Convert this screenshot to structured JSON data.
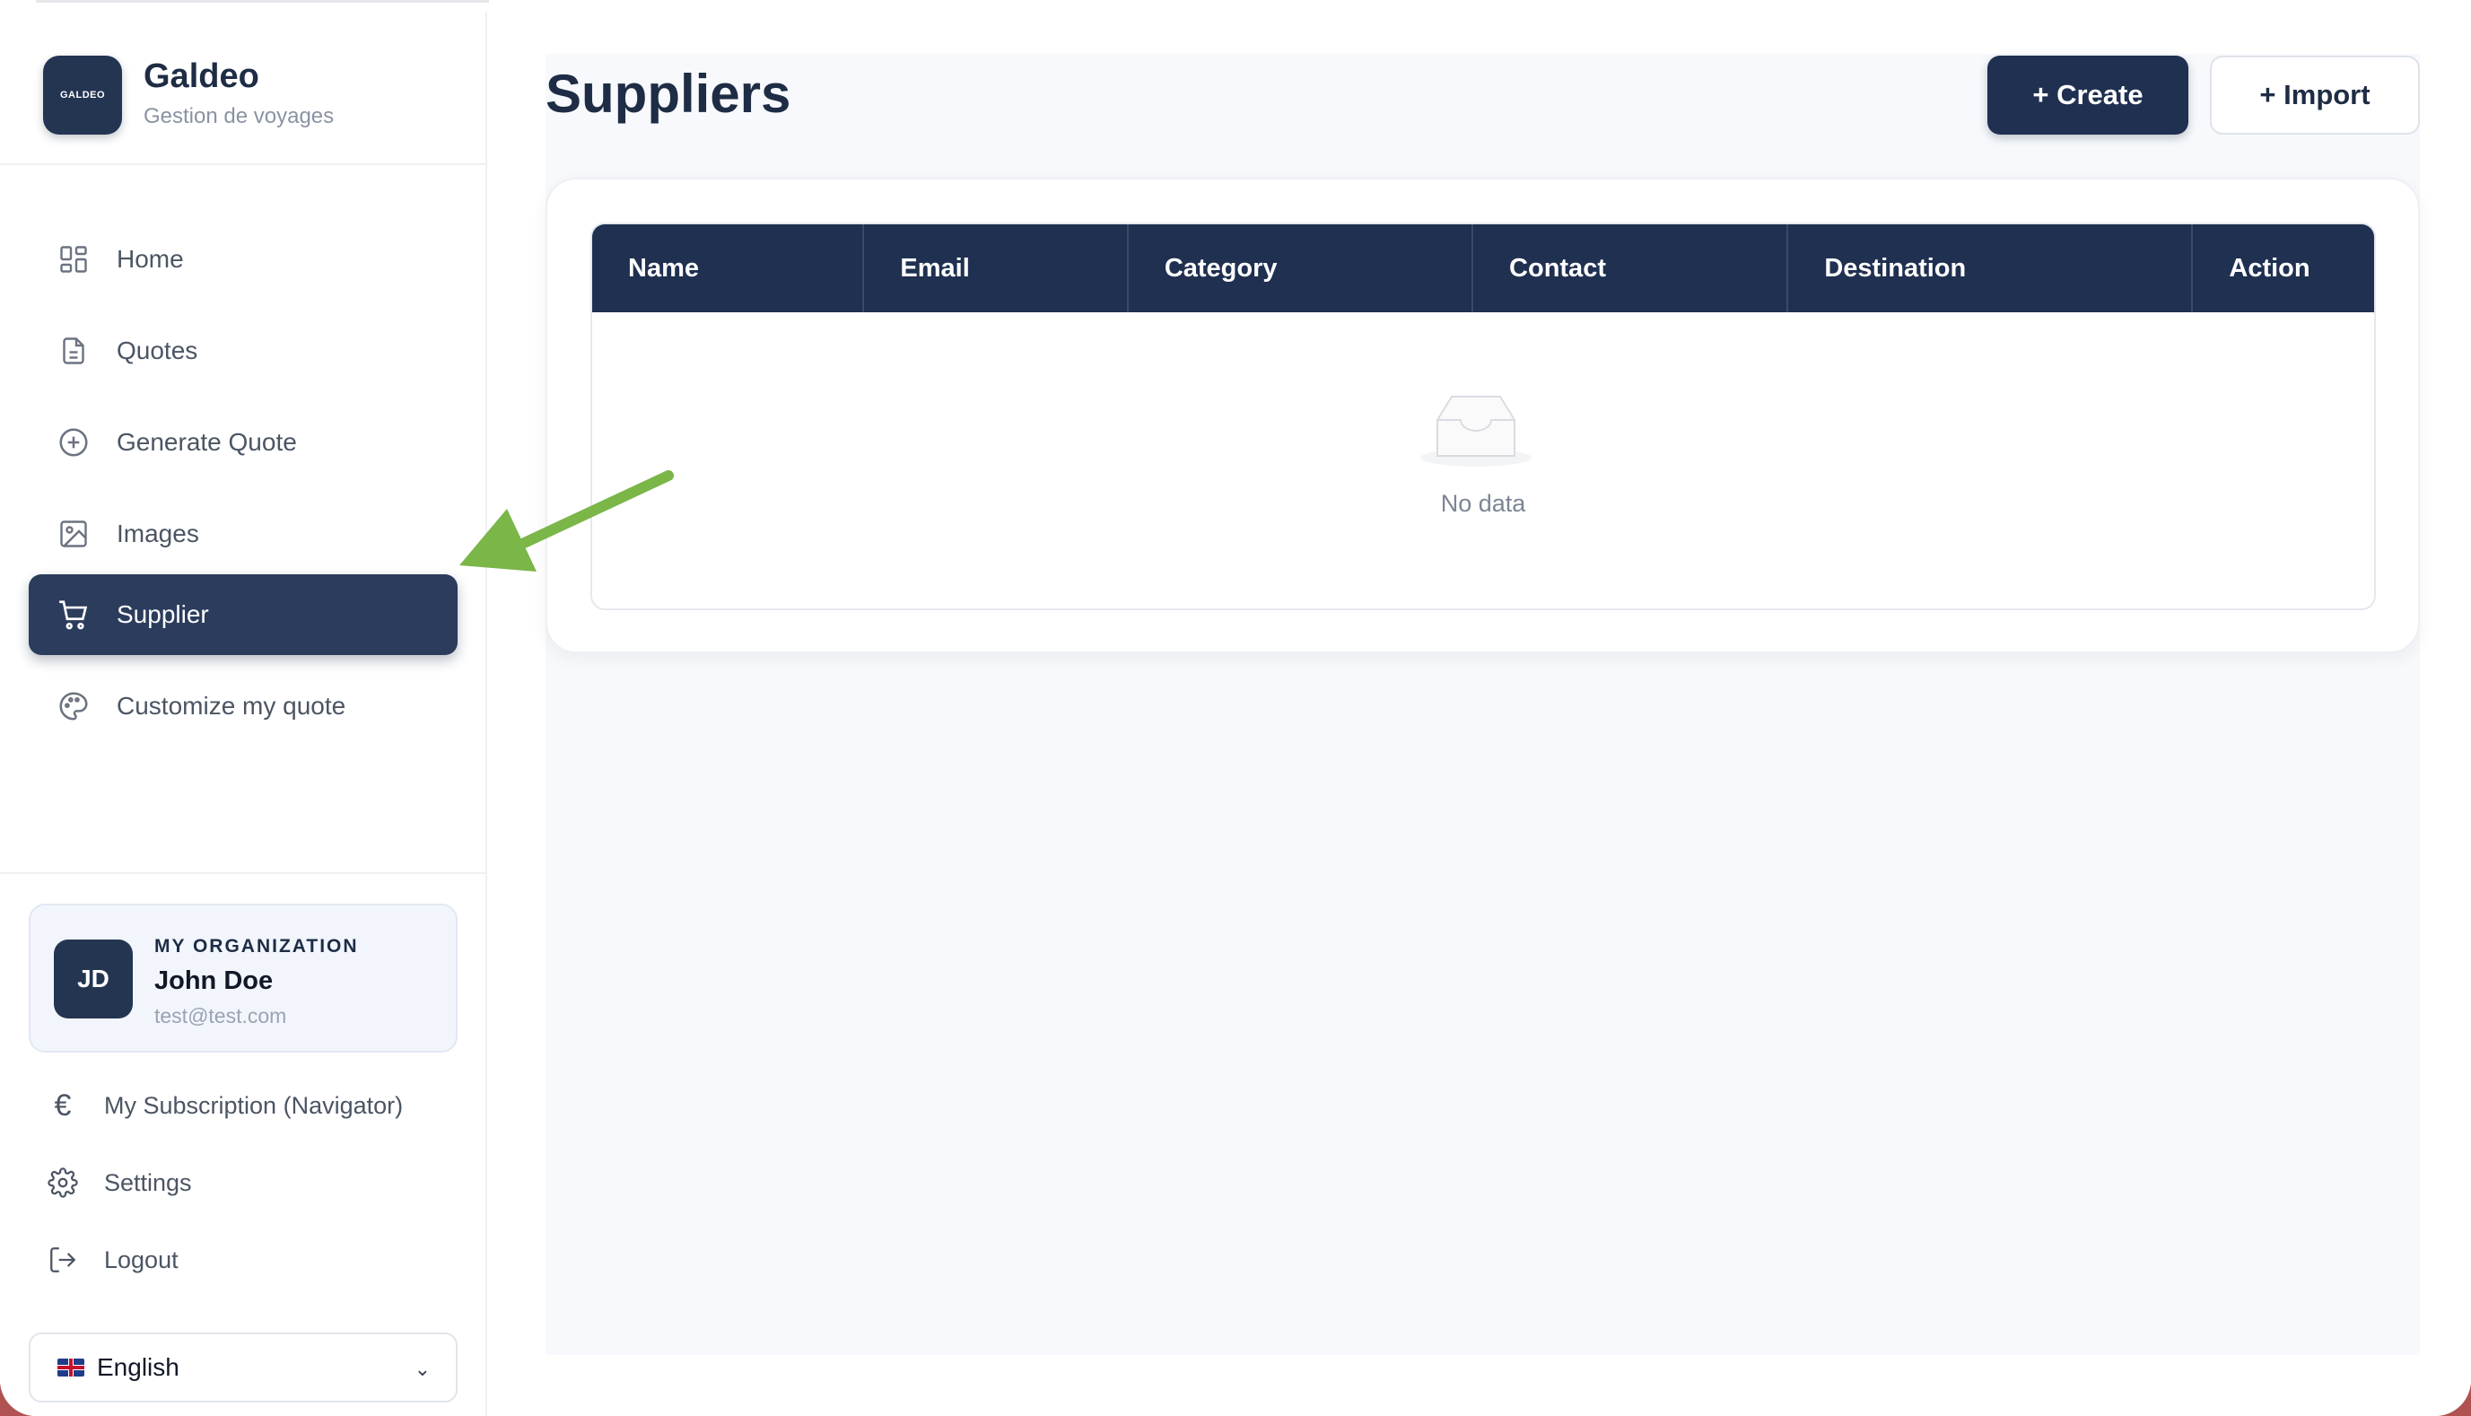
{
  "brand": {
    "logo_text": "GALDEO",
    "name": "Galdeo",
    "subtitle": "Gestion de voyages"
  },
  "nav": {
    "items": [
      {
        "label": "Home",
        "icon": "grid-icon",
        "active": false
      },
      {
        "label": "Quotes",
        "icon": "document-icon",
        "active": false
      },
      {
        "label": "Generate Quote",
        "icon": "plus-circle-icon",
        "active": false
      },
      {
        "label": "Images",
        "icon": "image-icon",
        "active": false
      },
      {
        "label": "Supplier",
        "icon": "cart-icon",
        "active": true
      },
      {
        "label": "Customize my quote",
        "icon": "palette-icon",
        "active": false
      }
    ]
  },
  "organization": {
    "label": "MY ORGANIZATION",
    "initials": "JD",
    "user_name": "John Doe",
    "email": "test@test.com"
  },
  "bottom_links": {
    "subscription": "My Subscription (Navigator)",
    "settings": "Settings",
    "logout": "Logout"
  },
  "language": {
    "selected": "English",
    "flag": "uk-flag-icon"
  },
  "page": {
    "title": "Suppliers",
    "create_label": "+ Create",
    "import_label": "+ Import"
  },
  "table": {
    "columns": [
      "Name",
      "Email",
      "Category",
      "Contact",
      "Destination",
      "Action"
    ],
    "rows": [],
    "empty_text": "No data"
  },
  "colors": {
    "primary": "#1f3050",
    "accent_arrow": "#7ab648",
    "background": "#f7f9fc"
  }
}
